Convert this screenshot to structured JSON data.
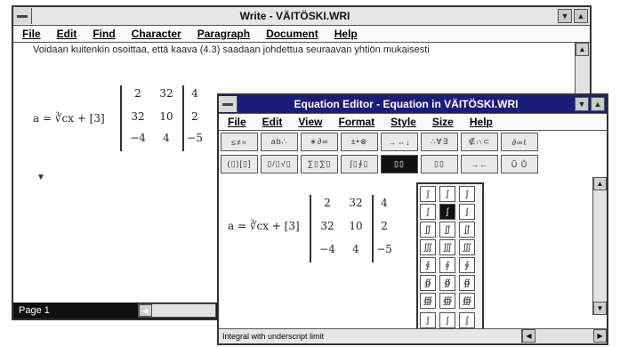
{
  "write": {
    "title": "Write - VÄITÖSKI.WRI",
    "menu": [
      "File",
      "Edit",
      "Find",
      "Character",
      "Paragraph",
      "Document",
      "Help"
    ],
    "body_text": "Voidaan kuitenkin osoittaa, että kaava (4.3) saadaan johdettua seuraavan yhtiön mukaisesti",
    "formula_lhs": "a = ∛cx + [3]",
    "matrix": [
      [
        "2",
        "32",
        "4"
      ],
      [
        "32",
        "10",
        "2"
      ],
      [
        "−4",
        "4",
        "−5"
      ]
    ],
    "status": "Page 1"
  },
  "equation_editor": {
    "title": "Equation Editor - Equation in VÄITÖSKI.WRI",
    "menu": [
      "File",
      "Edit",
      "View",
      "Format",
      "Style",
      "Size",
      "Help"
    ],
    "palette_row1": [
      "≤≠≈",
      "ab∴",
      "∗∂∞",
      "±•⊗",
      "→⇔↓",
      "∴∀∃",
      "∉∩⊂",
      "∂∞ℓ"
    ],
    "palette_row2": [
      "(▯)[▯]",
      "▯/▯√▯",
      "∑▯∑▯",
      "∫▯∮▯",
      "▯▯",
      "▯▯",
      "→←",
      "Ũ Ů"
    ],
    "formula_lhs": "a = ∛cx + [3]",
    "matrix": [
      [
        "2",
        "32",
        "4"
      ],
      [
        "32",
        "10",
        "2"
      ],
      [
        "−4",
        "4",
        "−5"
      ]
    ],
    "status": "Integral with underscript limit"
  },
  "colors": {
    "active_title": "#1c1c7a",
    "inactive_title": "#e6e6e6"
  }
}
